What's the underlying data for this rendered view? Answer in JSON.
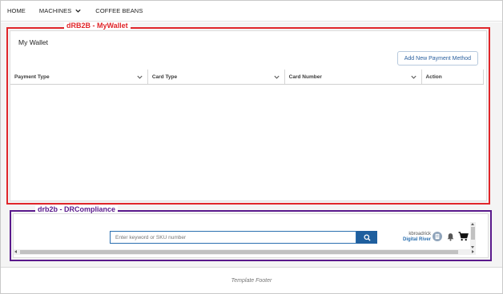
{
  "nav": {
    "items": [
      {
        "label": "HOME",
        "icon": null
      },
      {
        "label": "MACHINES",
        "icon": "chevron-down-icon"
      },
      {
        "label": "COFFEE BEANS",
        "icon": null
      }
    ]
  },
  "wallet_region": {
    "tag": "dRB2B - MyWallet",
    "tag_color": "#e0262a",
    "title": "My Wallet",
    "add_button_label": "Add New Payment Method",
    "columns": [
      {
        "label": "Payment Type",
        "sortable": true
      },
      {
        "label": "Card Type",
        "sortable": true
      },
      {
        "label": "Card Number",
        "sortable": true
      },
      {
        "label": "Action",
        "sortable": false
      }
    ]
  },
  "compliance_region": {
    "tag": "drb2b - DRCompliance",
    "tag_color": "#5a1a8c",
    "search": {
      "placeholder": "Enter keyword or SKU number"
    },
    "user": "kbroadrick",
    "brand": "Digital River",
    "icons": [
      "search-icon",
      "avatar-icon",
      "bell-icon",
      "cart-icon"
    ]
  },
  "footer": {
    "label": "Template Footer"
  },
  "colors": {
    "accent_blue": "#1f5f9e",
    "wallet_border": "#e0262a",
    "compliance_border": "#5a1a8c"
  }
}
